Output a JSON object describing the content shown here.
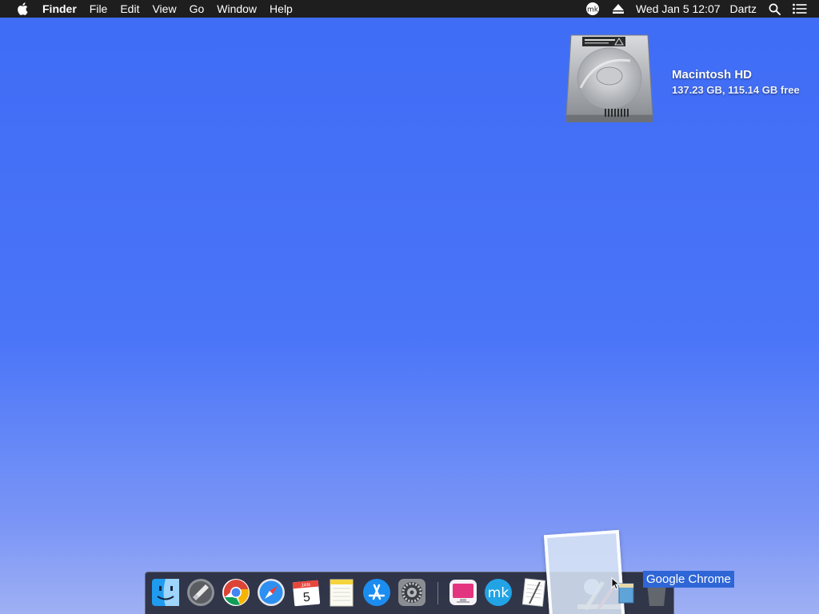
{
  "menubar": {
    "app_name": "Finder",
    "menus": [
      "File",
      "Edit",
      "View",
      "Go",
      "Window",
      "Help"
    ],
    "status": {
      "datetime": "Wed Jan 5  12:07",
      "user": "Dartz"
    }
  },
  "desktop": {
    "disk": {
      "name": "Macintosh HD",
      "info": "137.23 GB, 115.14 GB free"
    }
  },
  "dock": {
    "items": [
      {
        "name": "finder",
        "running": true
      },
      {
        "name": "launchpad",
        "running": false
      },
      {
        "name": "chrome",
        "running": true
      },
      {
        "name": "safari",
        "running": true
      },
      {
        "name": "calendar",
        "running": false,
        "month": "JAN",
        "day": "5"
      },
      {
        "name": "notes",
        "running": false
      },
      {
        "name": "app-store",
        "running": false
      },
      {
        "name": "system-preferences",
        "running": false
      },
      {
        "name": "cleanmymac",
        "running": false
      },
      {
        "name": "mk-app",
        "running": false,
        "glyph": "mk"
      },
      {
        "name": "textedit",
        "running": false
      },
      {
        "name": "xcode-tools",
        "running": false
      },
      {
        "name": "trash",
        "running": false
      }
    ],
    "tooltip": "Google Chrome"
  },
  "colors": {
    "menubar_bg": "#1e1e1e",
    "desktop_top": "#3f6cf6",
    "desktop_bottom": "#9fb0f3",
    "tooltip_bg": "#2f66d6"
  }
}
